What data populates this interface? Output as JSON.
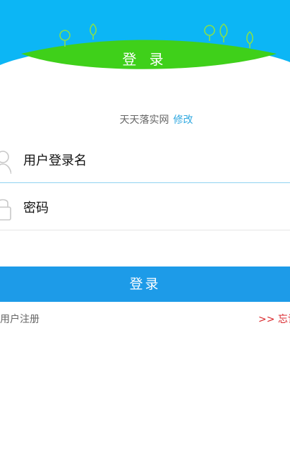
{
  "header": {
    "title": "登 录",
    "sky_color": "#0cb6f5",
    "hill_color": "#3fd01a",
    "tree_color": "#86e04b"
  },
  "site": {
    "name": "天天落实网",
    "modify_label": "修改"
  },
  "form": {
    "username_value": "用户登录名",
    "password_value": "密码",
    "user_icon": "user-icon",
    "lock_icon": "lock-icon"
  },
  "actions": {
    "login_label": "登录",
    "register_label": "用户注册",
    "forgot_label": ">> 忘记"
  },
  "colors": {
    "button": "#1d9be8",
    "link_blue": "#2fa8e0",
    "forgot_red": "#d9262b"
  }
}
